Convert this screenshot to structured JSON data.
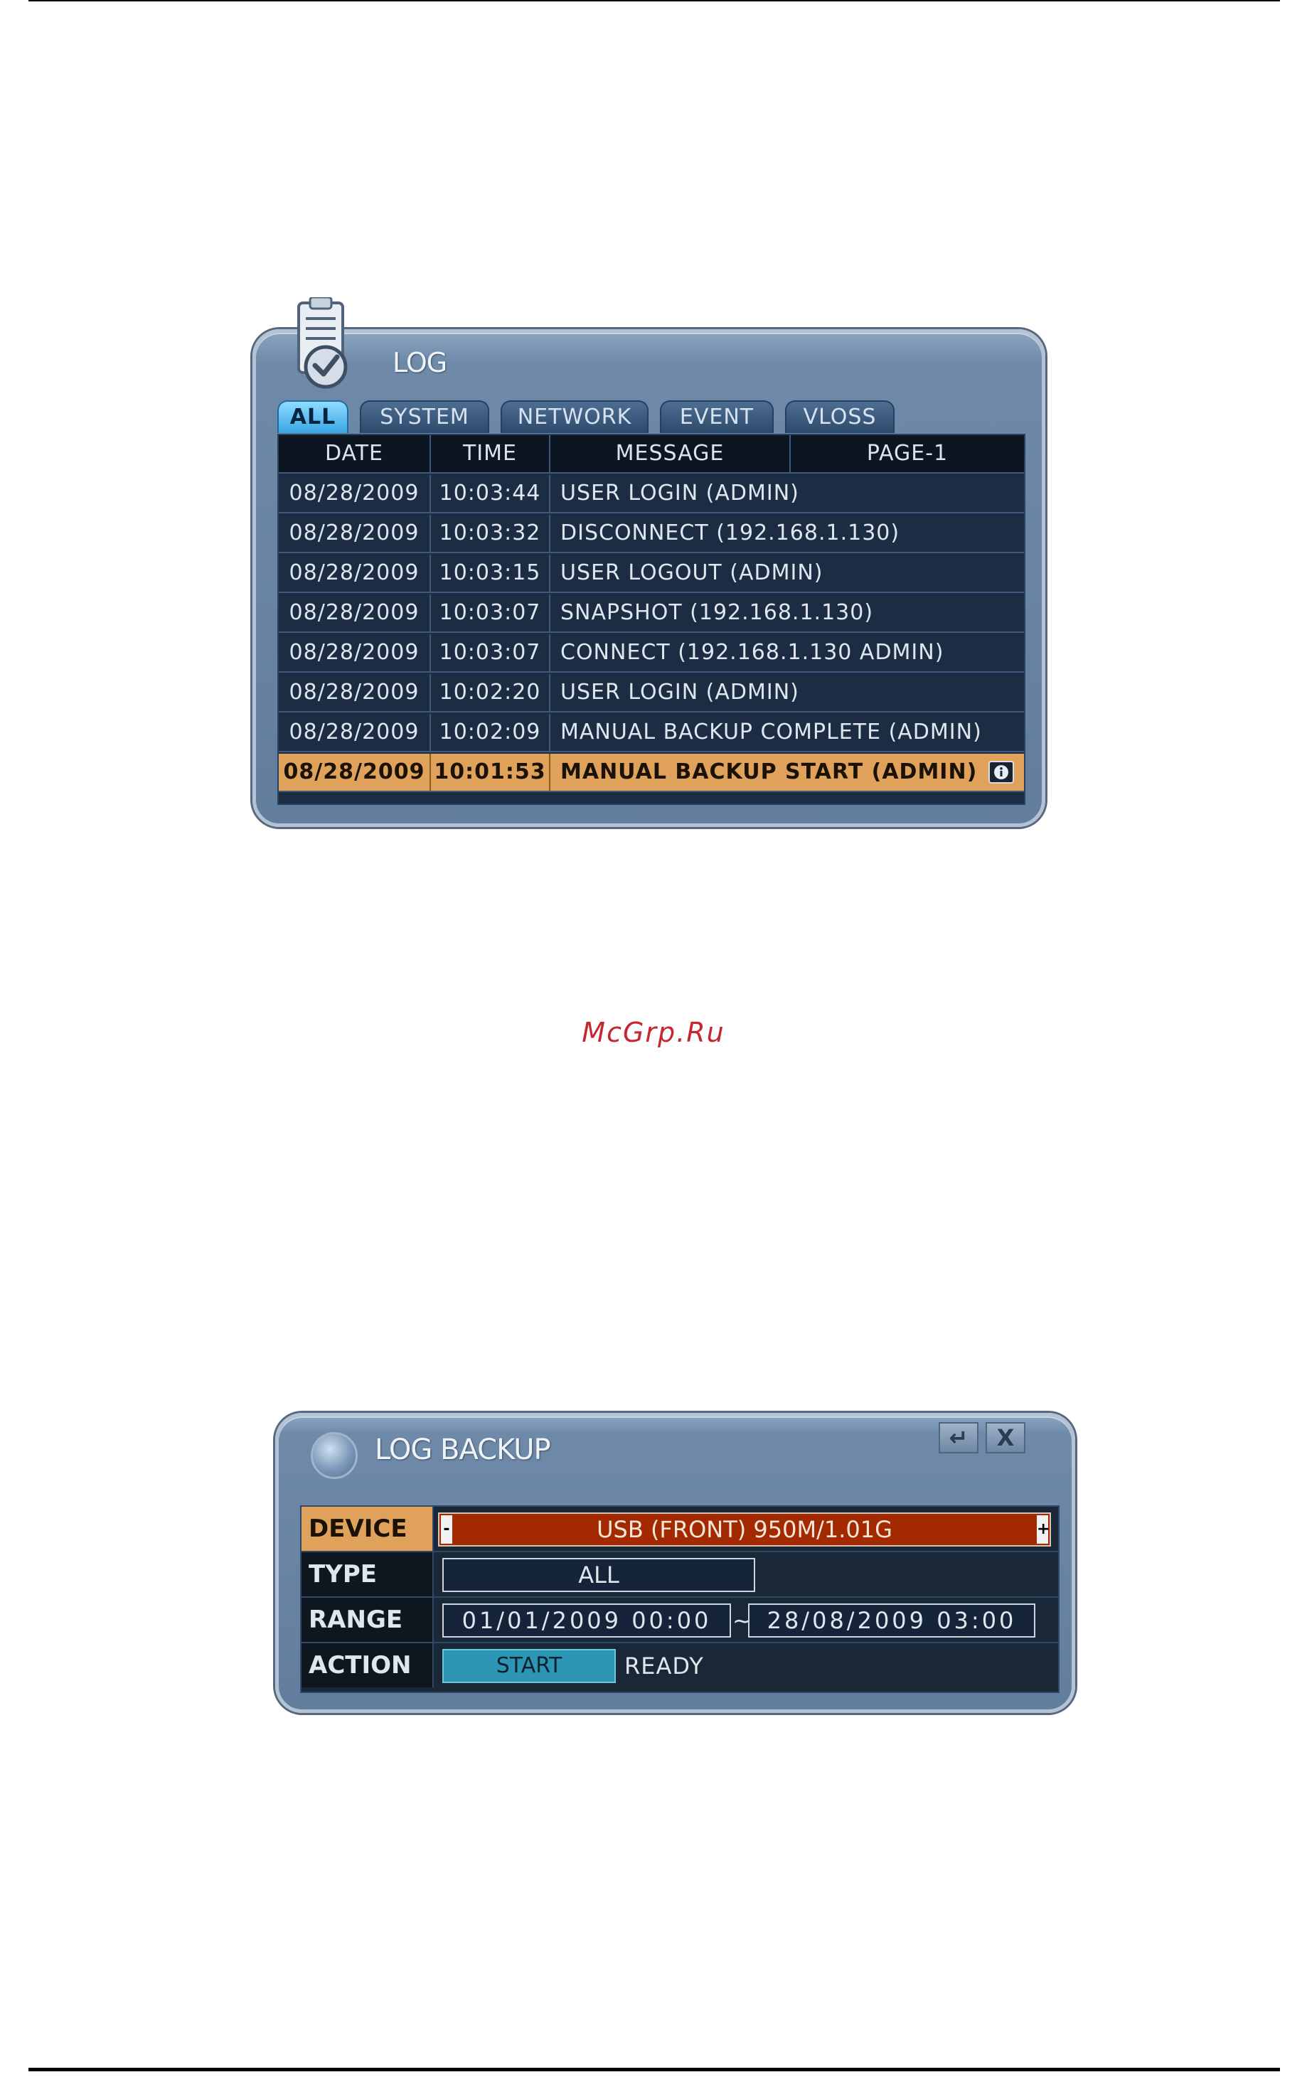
{
  "log": {
    "title": "LOG",
    "tabs": [
      {
        "label": "ALL",
        "active": true
      },
      {
        "label": "SYSTEM",
        "active": false
      },
      {
        "label": "NETWORK",
        "active": false
      },
      {
        "label": "EVENT",
        "active": false
      },
      {
        "label": "VLOSS",
        "active": false
      }
    ],
    "columns": {
      "date": "DATE",
      "time": "TIME",
      "message": "MESSAGE",
      "page": "PAGE-1"
    },
    "rows": [
      {
        "date": "08/28/2009",
        "time": "10:03:44",
        "message": "USER LOGIN (ADMIN)"
      },
      {
        "date": "08/28/2009",
        "time": "10:03:32",
        "message": "DISCONNECT (192.168.1.130)"
      },
      {
        "date": "08/28/2009",
        "time": "10:03:15",
        "message": "USER LOGOUT (ADMIN)"
      },
      {
        "date": "08/28/2009",
        "time": "10:03:07",
        "message": "SNAPSHOT (192.168.1.130)"
      },
      {
        "date": "08/28/2009",
        "time": "10:03:07",
        "message": "CONNECT (192.168.1.130 ADMIN)"
      },
      {
        "date": "08/28/2009",
        "time": "10:02:20",
        "message": "USER LOGIN (ADMIN)"
      },
      {
        "date": "08/28/2009",
        "time": "10:02:09",
        "message": "MANUAL BACKUP COMPLETE (ADMIN)"
      },
      {
        "date": "08/28/2009",
        "time": "10:01:53",
        "message": "MANUAL BACKUP START (ADMIN)",
        "selected": true
      }
    ]
  },
  "watermark": "McGrp.Ru",
  "backup": {
    "title": "LOG BACKUP",
    "enter_icon": "↵",
    "close_label": "X",
    "device_label": "DEVICE",
    "device_value": "USB (FRONT) 950M/1.01G",
    "spin_minus": "-",
    "spin_plus": "+",
    "type_label": "TYPE",
    "type_value": "ALL",
    "range_label": "RANGE",
    "range_from": "01/01/2009 00:00",
    "range_sep": "~",
    "range_to": "28/08/2009 03:00",
    "action_label": "ACTION",
    "start_label": "START",
    "status": "READY"
  },
  "colors": {
    "highlight": "#e0a25a",
    "device_bg": "#a32a00",
    "start_bg": "#2c96b4",
    "watermark": "#c5262f"
  }
}
